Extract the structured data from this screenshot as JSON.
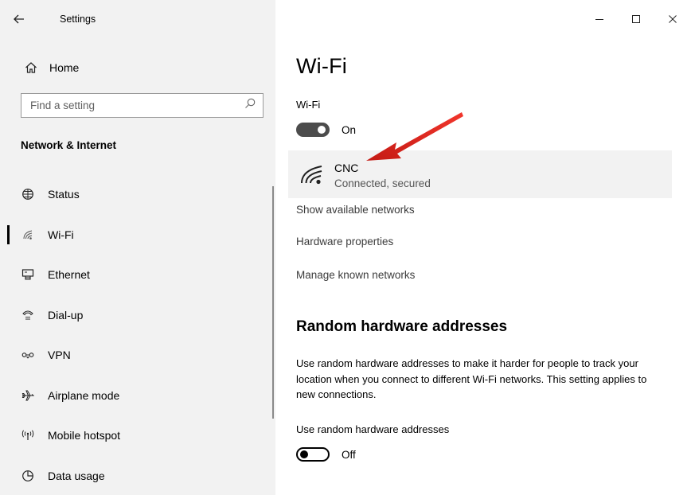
{
  "window": {
    "title": "Settings",
    "controls": {
      "minimize": "—",
      "maximize": "☐",
      "close": "✕"
    }
  },
  "sidebar": {
    "home_label": "Home",
    "search_placeholder": "Find a setting",
    "section_heading": "Network & Internet",
    "items": [
      {
        "label": "Status",
        "icon": "globe-icon"
      },
      {
        "label": "Wi-Fi",
        "icon": "wifi-icon",
        "selected": true
      },
      {
        "label": "Ethernet",
        "icon": "ethernet-icon"
      },
      {
        "label": "Dial-up",
        "icon": "dialup-icon"
      },
      {
        "label": "VPN",
        "icon": "vpn-icon"
      },
      {
        "label": "Airplane mode",
        "icon": "airplane-icon"
      },
      {
        "label": "Mobile hotspot",
        "icon": "hotspot-icon"
      },
      {
        "label": "Data usage",
        "icon": "data-usage-icon"
      }
    ]
  },
  "main": {
    "title": "Wi-Fi",
    "wifi_toggle": {
      "label": "Wi-Fi",
      "state_text": "On",
      "on": true
    },
    "connected_network": {
      "name": "CNC",
      "status": "Connected, secured"
    },
    "links": [
      "Show available networks",
      "Hardware properties",
      "Manage known networks"
    ],
    "random_hw": {
      "heading": "Random hardware addresses",
      "description": "Use random hardware addresses to make it harder for people to track your location when you connect to different Wi-Fi networks. This setting applies to new connections.",
      "toggle_label": "Use random hardware addresses",
      "state_text": "Off",
      "on": false
    }
  },
  "colors": {
    "sidebar_bg": "#f2f2f2",
    "card_bg": "#f2f2f2",
    "toggle_on": "#4c4c4c",
    "annotation_arrow": "#e8261f"
  }
}
